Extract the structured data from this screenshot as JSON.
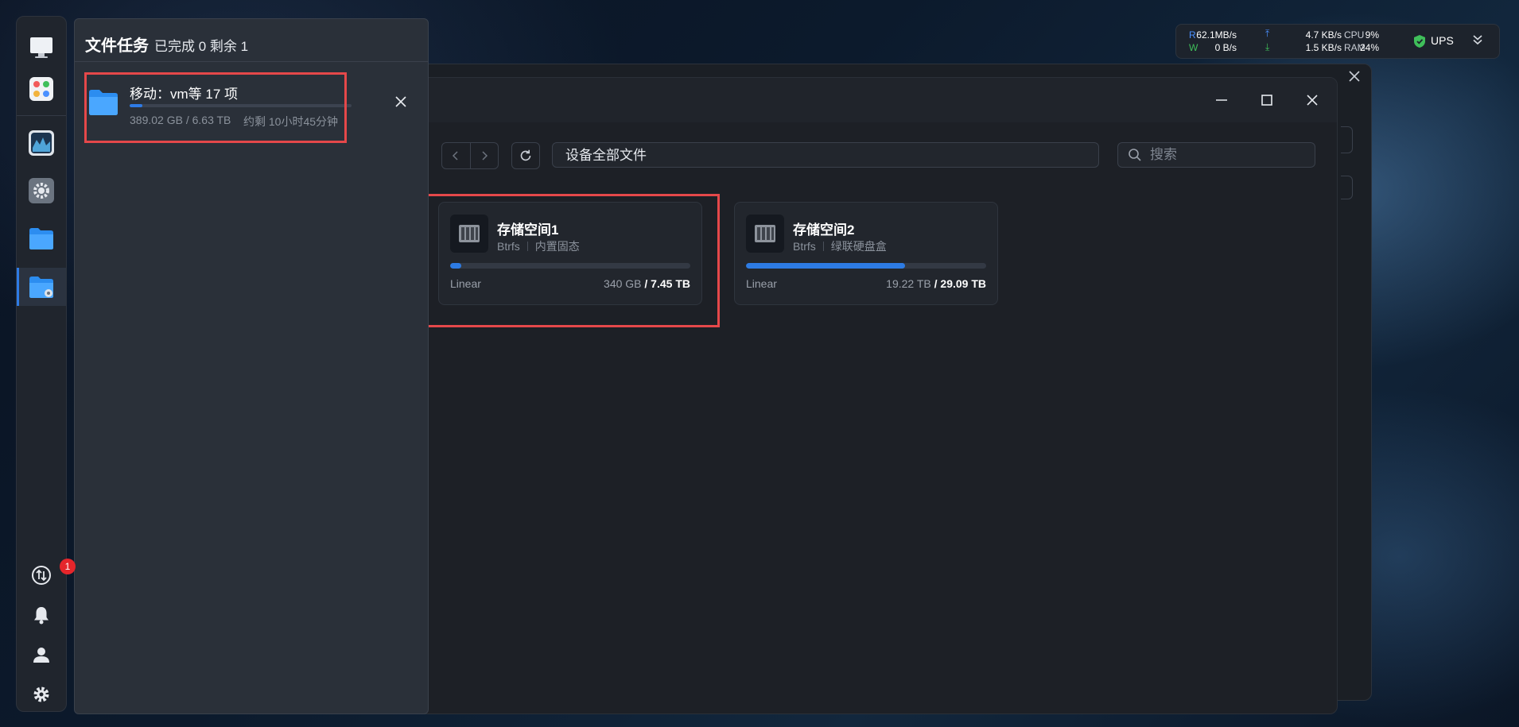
{
  "status_bar": {
    "read_label": "R",
    "write_label": "W",
    "read_speed": "62.1MB/s",
    "write_speed": "0  B/s",
    "upload_speed": "4.7 KB/s",
    "download_speed": "1.5 KB/s",
    "cpu_label": "CPU",
    "ram_label": "RAM",
    "cpu_value": "9%",
    "ram_value": "24%",
    "ups_label": "UPS"
  },
  "dock": {
    "task_badge": "1"
  },
  "task_panel": {
    "title": "文件任务",
    "status": "已完成 0 剩余 1",
    "task": {
      "name": "移动：vm等 17 项",
      "size": "389.02 GB / 6.63 TB",
      "remaining": "约剩 10小时45分钟",
      "progress": 0.058
    }
  },
  "file_manager": {
    "path": "设备全部文件",
    "search_placeholder": "搜索",
    "volumes": [
      {
        "name": "存储空间1",
        "fs": "Btrfs",
        "desc": "内置固态",
        "type": "Linear",
        "used": "340 GB",
        "total": "/ 7.45 TB",
        "usage": 0.045
      },
      {
        "name": "存储空间2",
        "fs": "Btrfs",
        "desc": "绿联硬盘盒",
        "type": "Linear",
        "used": "19.22 TB",
        "total": "/ 29.09 TB",
        "usage": 0.661
      }
    ]
  },
  "colors": {
    "accent": "#2e7be6",
    "highlight": "#e5484a",
    "badge": "#e5262b"
  }
}
